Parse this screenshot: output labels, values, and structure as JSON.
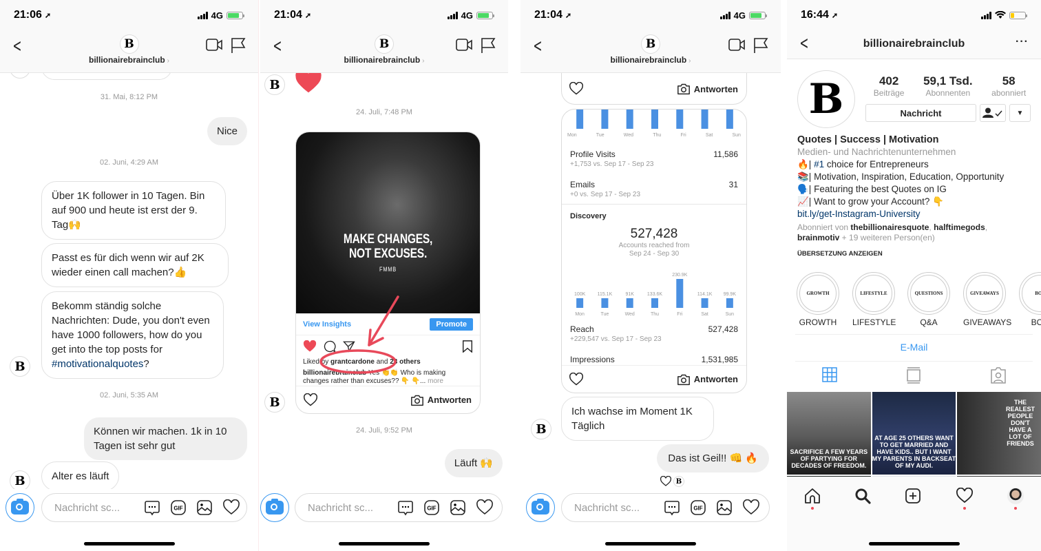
{
  "accent": "#3897f0",
  "heart_color": "#ed4956",
  "chat": {
    "username": "billionairebrainclub",
    "avatar_letter": "B",
    "composer_placeholder": "Nachricht sc...",
    "reply_label": "Antworten"
  },
  "screen1": {
    "status_time": "21:06",
    "network": "4G",
    "messages": [
      {
        "type": "timestamp",
        "text": "31. Mai, 8:12 PM"
      },
      {
        "type": "sent",
        "text": "Nice"
      },
      {
        "type": "timestamp",
        "text": "02. Juni, 4:29 AM"
      },
      {
        "type": "received",
        "text": "Über 1K follower in 10 Tagen. Bin auf 900 und heute ist erst der 9. Tag🙌"
      },
      {
        "type": "received",
        "text": "Passt es für dich wenn wir auf 2K wieder einen call machen?👍"
      },
      {
        "type": "received",
        "text_before": "Bekomm ständig solche Nachrichten: Dude, you don't even have 1000 followers, how do you get into the top posts for ",
        "hashtag": "#motivationalquotes",
        "text_after": "?"
      },
      {
        "type": "timestamp",
        "text": "02. Juni, 5:35 AM"
      },
      {
        "type": "sent",
        "text": "Können wir machen. 1k in 10 Tagen ist sehr gut"
      },
      {
        "type": "received",
        "text": "Alter es läuft"
      }
    ]
  },
  "screen2": {
    "status_time": "21:04",
    "network": "4G",
    "ts1": "24. Juli, 7:48 PM",
    "post": {
      "quote_line1": "MAKE CHANGES,",
      "quote_line2": "NOT EXCUSES.",
      "signature": "FMMB",
      "view_insights": "View Insights",
      "promote": "Promote",
      "liked_prefix": "Liked by ",
      "liked_user": "grantcardone",
      "liked_mid": " and ",
      "liked_others": "23 others",
      "caption_user": "billionairebrainclub",
      "caption_text": " Yes 👏👏 Who is making changes rather than excuses?? 👇 👇...",
      "caption_more": " more"
    },
    "ts2": "24. Juli, 9:52 PM",
    "sent_msg": "Läuft 🙌"
  },
  "screen3": {
    "status_time": "21:04",
    "network": "4G",
    "days": [
      "Mon",
      "Tue",
      "Wed",
      "Thu",
      "Fri",
      "Sat",
      "Sun"
    ],
    "profile_visits": {
      "label": "Profile Visits",
      "value": "11,586",
      "delta": "+1,753 vs. Sep 17 - Sep 23"
    },
    "emails": {
      "label": "Emails",
      "value": "31",
      "delta": "+0 vs. Sep 17 - Sep 23"
    },
    "discovery": {
      "title": "Discovery",
      "total": "527,428",
      "subtitle_line1": "Accounts reached from",
      "subtitle_line2": "Sep 24 - Sep 30"
    },
    "reach": {
      "label": "Reach",
      "value": "527,428",
      "delta": "+229,547 vs. Sep 17 - Sep 23"
    },
    "impressions": {
      "label": "Impressions",
      "value": "1,531,985"
    },
    "received_msg": "Ich wachse im Moment 1K Täglich",
    "sent_msg": "Das ist Geil!! 👊 🔥"
  },
  "chart_data": {
    "type": "bar",
    "title": "Accounts reached",
    "categories": [
      "Mon",
      "Tue",
      "Wed",
      "Thu",
      "Fri",
      "Sat",
      "Sun"
    ],
    "values": [
      100000,
      115100,
      91000,
      133600,
      230900,
      114100,
      99900
    ],
    "labels": [
      "100K",
      "115.1K",
      "91K",
      "133.6K",
      "230.9K",
      "114.1K",
      "99.9K"
    ],
    "xlabel": "",
    "ylabel": "",
    "ylim": [
      0,
      230900
    ],
    "grid": false
  },
  "screen4": {
    "status_time": "16:44",
    "username": "billionairebrainclub",
    "posts_count": "402",
    "posts_label": "Beiträge",
    "followers_count": "59,1 Tsd.",
    "followers_label": "Abonnenten",
    "following_count": "58",
    "following_label": "abonniert",
    "message_button": "Nachricht",
    "bio_name": "Quotes | Success | Motivation",
    "category": "Medien- und Nachrichtenunternehmen",
    "bio_line1_pre": "🔥| ",
    "bio_line1_tag": "#1",
    "bio_line1_post": " choice for Entrepreneurs",
    "bio_line2": "📚| Motivation, Inspiration, Education, Opportunity",
    "bio_line3": "🗣️| Featuring the best Quotes on IG",
    "bio_line4": "📈| Want to grow your Account? 👇",
    "link": "bit.ly/get-Instagram-University",
    "followed_by_prefix": "Abonniert von ",
    "followed_by_1": "thebillionairesquote",
    "followed_by_2": "halftimegods",
    "followed_by_3": "brainmotiv",
    "followed_by_suffix": " + 19 weiteren Person(en)",
    "translate": "ÜBERSETZUNG ANZEIGEN",
    "highlights": [
      {
        "inner": "GROWTH",
        "label": "GROWTH"
      },
      {
        "inner": "LIFESTYLE",
        "label": "LIFESTYLE"
      },
      {
        "inner": "QUESTIONS",
        "label": "Q&A"
      },
      {
        "inner": "GIVEAWAYS",
        "label": "GIVEAWAYS"
      },
      {
        "inner": "BOO",
        "label": "BOO"
      }
    ],
    "email": "E-Mail",
    "grid_posts": [
      "SACRIFICE A FEW YEARS OF PARTYING FOR DECADES OF FREEDOM.",
      "AT AGE 25 OTHERS WANT TO GET MARRIED AND HAVE KIDS.. BUT I WANT MY PARENTS IN BACKSEAT OF MY AUDI.",
      "THE REALEST PEOPLE DON'T HAVE A LOT OF FRIENDS"
    ]
  }
}
